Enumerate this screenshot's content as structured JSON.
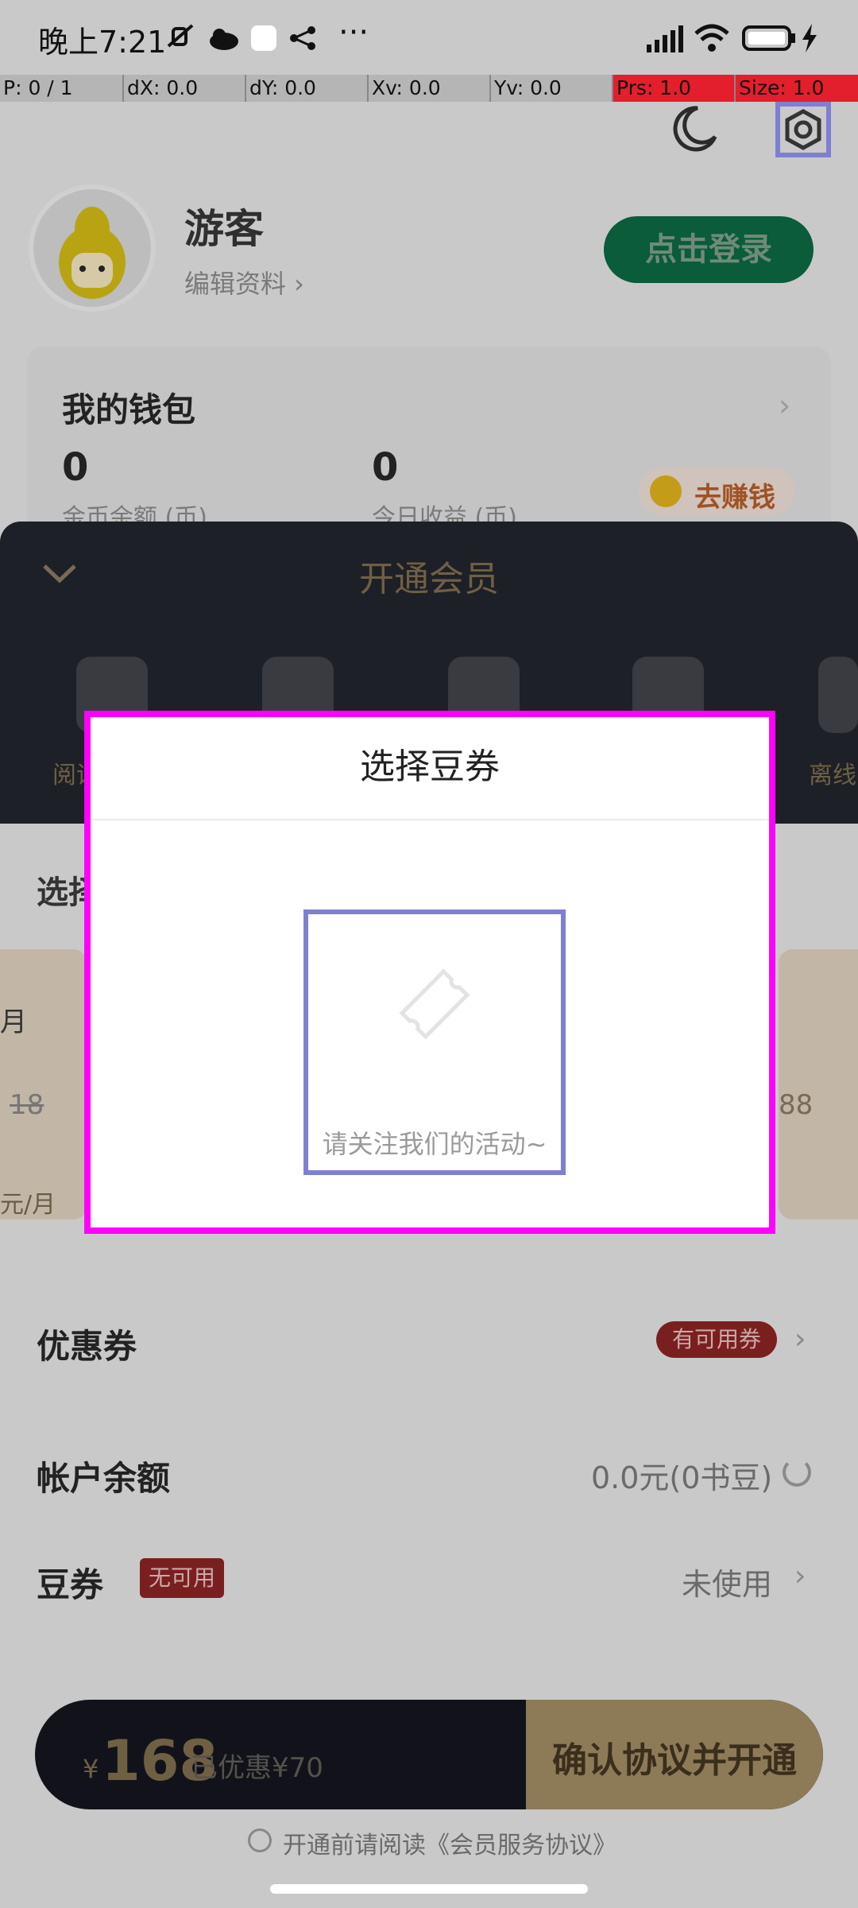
{
  "status_bar": {
    "time": "晚上7:21"
  },
  "debug_bar": {
    "p": "P: 0 / 1",
    "dx": "dX: 0.0",
    "dy": "dY: 0.0",
    "xv": "Xv: 0.0",
    "yv": "Yv: 0.0",
    "prs": "Prs: 1.0",
    "size": "Size: 1.0"
  },
  "profile": {
    "name": "游客",
    "edit_label": "编辑资料 ›",
    "login_button": "点击登录"
  },
  "wallet": {
    "title": "我的钱包",
    "coin_balance": "0",
    "coin_balance_label": "金币余额 (币)",
    "today_earnings": "0",
    "today_earnings_label": "今日收益 (币)",
    "earn_button": "去赚钱"
  },
  "membership_sheet": {
    "title": "开通会员",
    "privilege_label_left": "阅读",
    "privilege_label_right": "离线",
    "select_plan_label": "选择",
    "plan_left": {
      "period": "月",
      "original_price": "18",
      "unit_price": "元/月"
    },
    "plan_right": {
      "price_fragment": "88"
    },
    "coupon_label": "优惠券",
    "coupon_badge": "有可用券",
    "balance_label": "帐户余额",
    "balance_value": "0.0元(0书豆)",
    "bean_coupon_label": "豆券",
    "bean_coupon_badge": "无可用",
    "bean_coupon_value": "未使用",
    "pay_bar": {
      "currency": "¥",
      "price": "168",
      "discount": "已优惠¥70",
      "confirm_button": "确认协议并开通"
    },
    "agreement": "开通前请阅读《会员服务协议》"
  },
  "dialog": {
    "title": "选择豆券",
    "empty_text": "请关注我们的活动~"
  },
  "colors": {
    "dialog_border": "#ff00ff",
    "highlight_border": "#7f7fd1",
    "login_button": "#0a5c3b"
  }
}
